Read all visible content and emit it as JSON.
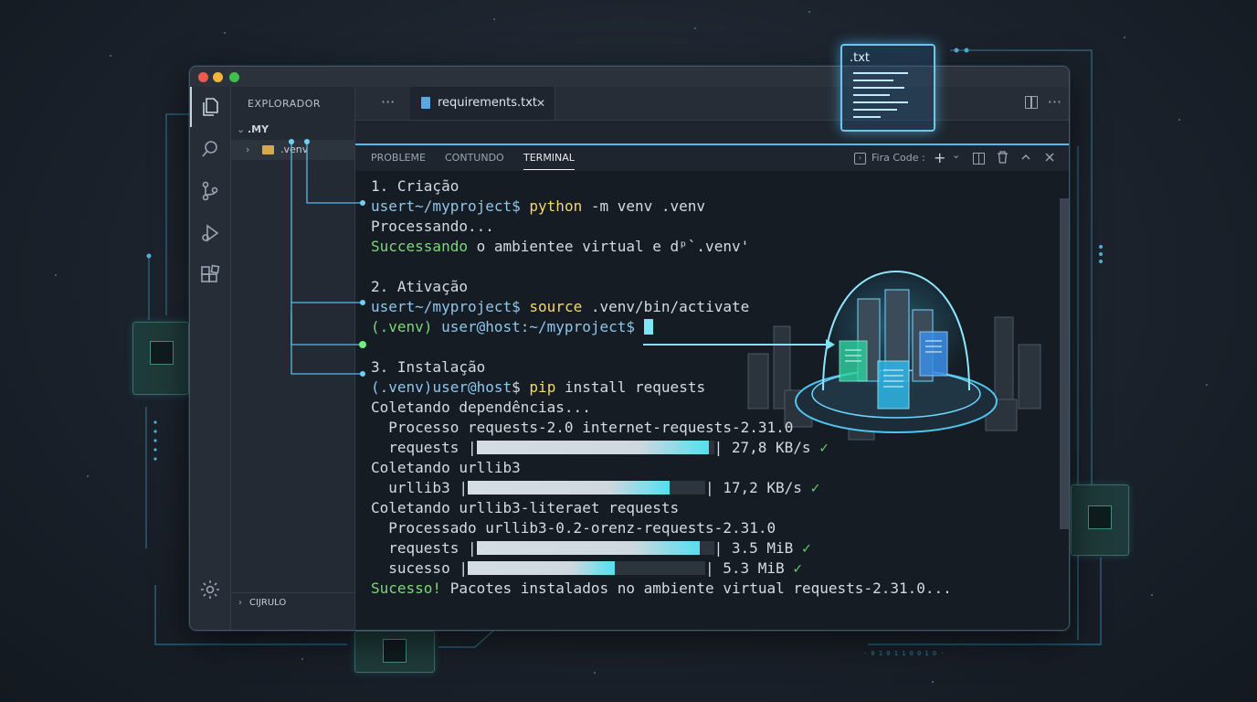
{
  "explorer": {
    "title": "EXPLORADOR",
    "folder": ".MY",
    "subfolder": ".venv",
    "footer_section": "CIJRULO"
  },
  "tabs": {
    "more": "···",
    "file_name": "requirements.txt",
    "close": "✕",
    "right_more": "···"
  },
  "panel": {
    "tabs": [
      "PROBLEME",
      "CONTUNDO",
      "TERMINAL"
    ],
    "active_tab": "TERMINAL",
    "shell_label": "Fira Code :",
    "add": "+",
    "dropdown": "⌄"
  },
  "floating_file": {
    "label": ".txt"
  },
  "terminal": {
    "step1": "1. Criação",
    "prompt1_user": "usert~/myproject$",
    "prompt1_cmd": "python",
    "prompt1_args": " -m venv .venv",
    "processing": "Processando...",
    "success1_green": "Successando",
    "success1_rest": " o ambientee virtual e dᵖ`.venv'",
    "step2": "2. Ativação",
    "prompt2_user": "usert~/myproject$",
    "prompt2_cmd": "source",
    "prompt2_args": " .venv/bin/activate",
    "venv_tag": "(.venv)",
    "prompt3_user": " user@host",
    "prompt3_path": ":~/myproject$",
    "step3": "3. Instalação",
    "prompt4_venv": "(.venv)",
    "prompt4_user": "user@host",
    "prompt4_dollar": "$",
    "prompt4_cmd": "pip",
    "prompt4_args": " install requests",
    "collecting_deps": "Coletando dependências...",
    "process_line": "  Processo requests-2.0 internet-requests-2.31.0",
    "collecting_urllib": "Coletando urllib3",
    "collecting_literal": "Coletando urllib3-literaet requests",
    "processed_line": "  Processado urllib3-0.2-orenz-requests-2.31.0",
    "final_green": "Sucesso!",
    "final_rest": " Pacotes instalados no ambiente virtual requests-2.31.0..."
  },
  "progress": [
    {
      "label": "requests",
      "value": "27,8 KB/s",
      "fraction": 0.98
    },
    {
      "label": "urllib3",
      "value": "17,2 KB/s",
      "fraction": 0.85
    },
    {
      "label": "requests",
      "value": "3.5 MiB",
      "fraction": 0.94
    },
    {
      "label": "sucesso",
      "value": "5.3 MiB",
      "fraction": 0.62
    }
  ],
  "check": "✓",
  "colors": {
    "accent": "#5ab8e6",
    "user": "#8fc6ec",
    "command": "#f3d870",
    "success": "#7fd67a",
    "cursor": "#7ee4f6"
  },
  "icons": {
    "files": "files-icon",
    "search": "search-icon",
    "git": "source-control-icon",
    "debug": "run-debug-icon",
    "extensions": "extensions-icon",
    "settings": "gear-icon"
  }
}
